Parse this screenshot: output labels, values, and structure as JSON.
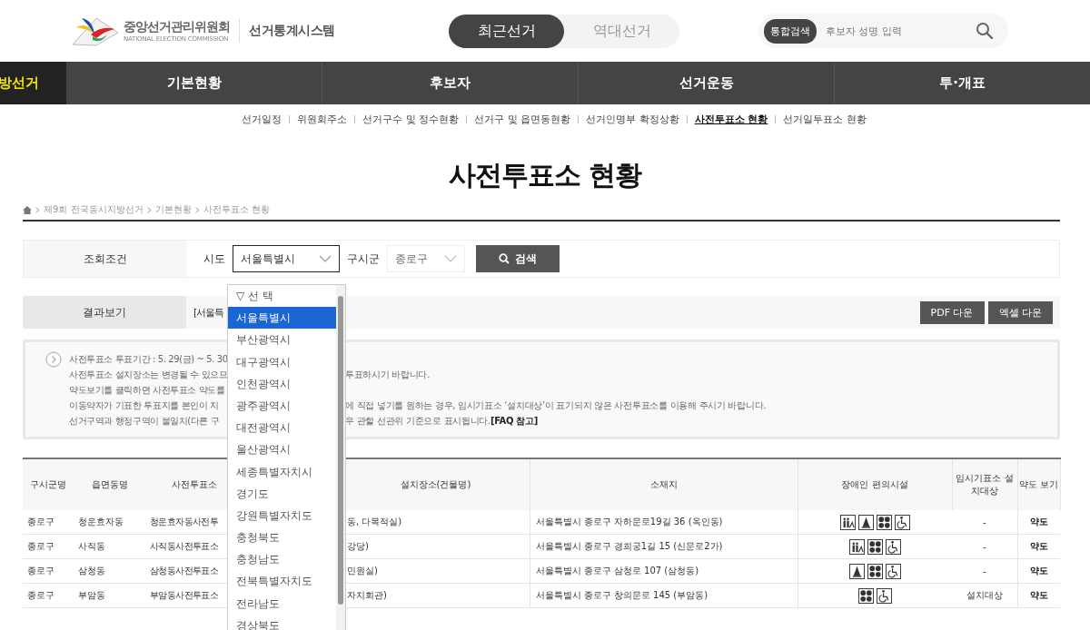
{
  "header": {
    "org_name": "중앙선거관리위원회",
    "org_name_en": "NATIONAL ELECTION COMMISSION",
    "system_name": "선거통계시스템",
    "election_tabs": [
      {
        "label": "최근선거",
        "selected": true
      },
      {
        "label": "역대선거",
        "selected": false
      }
    ],
    "search": {
      "badge": "통합검색",
      "placeholder": "후보자 성명 입력"
    }
  },
  "nav": {
    "current": "방선거",
    "items": [
      "기본현황",
      "후보자",
      "선거운동",
      "투·개표"
    ]
  },
  "sub_nav": [
    {
      "label": "선거일정",
      "selected": false
    },
    {
      "label": "위원회주소",
      "selected": false
    },
    {
      "label": "선거구수 및 정수현황",
      "selected": false
    },
    {
      "label": "선거구 및 읍면동현황",
      "selected": false
    },
    {
      "label": "선거인명부 확정상황",
      "selected": false
    },
    {
      "label": "사전투표소 현황",
      "selected": true
    },
    {
      "label": "선거일투표소 현황",
      "selected": false
    }
  ],
  "page_title": "사전투표소 현황",
  "breadcrumb": [
    "제9회 전국동시지방선거",
    "기본현황",
    "사전투표소 현황"
  ],
  "query": {
    "label": "조회조건",
    "sido_label": "시도",
    "sido_value": "서울특별시",
    "sido_expanded": true,
    "sigungu_label": "구시군",
    "sigungu_value": "종로구",
    "search_button": "검색",
    "sido_options": [
      {
        "label": "▽ 선 택",
        "selected": false
      },
      {
        "label": "서울특별시",
        "selected": true
      },
      {
        "label": "부산광역시",
        "selected": false
      },
      {
        "label": "대구광역시",
        "selected": false
      },
      {
        "label": "인천광역시",
        "selected": false
      },
      {
        "label": "광주광역시",
        "selected": false
      },
      {
        "label": "대전광역시",
        "selected": false
      },
      {
        "label": "울산광역시",
        "selected": false
      },
      {
        "label": "세종특별자치시",
        "selected": false
      },
      {
        "label": "경기도",
        "selected": false
      },
      {
        "label": "강원특별자치도",
        "selected": false
      },
      {
        "label": "충청북도",
        "selected": false
      },
      {
        "label": "충청남도",
        "selected": false
      },
      {
        "label": "전북특별자치도",
        "selected": false
      },
      {
        "label": "전라남도",
        "selected": false
      },
      {
        "label": "경상북도",
        "selected": false
      }
    ]
  },
  "results": {
    "label": "결과보기",
    "summary": "[서울특",
    "buttons": [
      "PDF 다운",
      "엑셀 다운"
    ]
  },
  "notice": [
    {
      "left": "사전투표소 투표기간 : 5. 29(금) ~ 5. 30"
    },
    {
      "left": "사전투표소 설치장소는 변경될 수 있으므",
      "right": "투표하시기 바랍니다."
    },
    {
      "left": "약도보기를 클릭하면 사전투표소 약도를"
    },
    {
      "left": "이동약자가 기표한 투표지를 본인이 지",
      "right": "에 직접 넣기를 원하는 경우, 임시기표소 ‘설치대상’이 표기되지 않은 사전투표소를 이용해 주시기 바랍니다."
    },
    {
      "left": "선거구역과 행정구역이 불일치(다른 구",
      "right": "우 관할 선관위 기준으로 표시됩니다.**[FAQ 참고]**"
    }
  ],
  "table": {
    "columns": [
      "구시군명",
      "읍면동명",
      "사전투표소",
      "설치장소(건물명)",
      "소재지",
      "장애인 편의시설",
      "임시기표소 설치대상",
      "약도 보기"
    ],
    "rows": [
      {
        "gu": "종로구",
        "dong": "청운효자동",
        "station": "청운효자동사전투",
        "place": "동, 다목적실)",
        "address": "서울특별시 종로구 자하문로19길 36 (옥인동)",
        "facilities": [
          {
            "kind": "elevator"
          },
          {
            "kind": "cone"
          },
          {
            "kind": "dots"
          },
          {
            "kind": "wheelchair"
          }
        ],
        "temp_booth": "-",
        "map": "약도"
      },
      {
        "gu": "종로구",
        "dong": "사직동",
        "station": "사직동사전투표소",
        "place": "강당)",
        "address": "서울특별시 종로구 경희궁1길 15 (신문로2가)",
        "facilities": [
          {
            "kind": "elevator"
          },
          {
            "kind": "dots"
          },
          {
            "kind": "wheelchair"
          }
        ],
        "temp_booth": "-",
        "map": "약도"
      },
      {
        "gu": "종로구",
        "dong": "삼청동",
        "station": "삼청동사전투표소",
        "place": "민원실)",
        "address": "서울특별시 종로구 삼청로 107 (삼청동)",
        "facilities": [
          {
            "kind": "cone"
          },
          {
            "kind": "dots"
          },
          {
            "kind": "wheelchair"
          }
        ],
        "temp_booth": "-",
        "map": "약도"
      },
      {
        "gu": "종로구",
        "dong": "부암동",
        "station": "부암동사전투표소",
        "place": "자치회관)",
        "address": "서울특별시 종로구 창의문로 145 (부암동)",
        "facilities": [
          {
            "kind": "dots"
          },
          {
            "kind": "wheelchair"
          }
        ],
        "temp_booth": "설치대상",
        "map": "약도"
      }
    ]
  }
}
